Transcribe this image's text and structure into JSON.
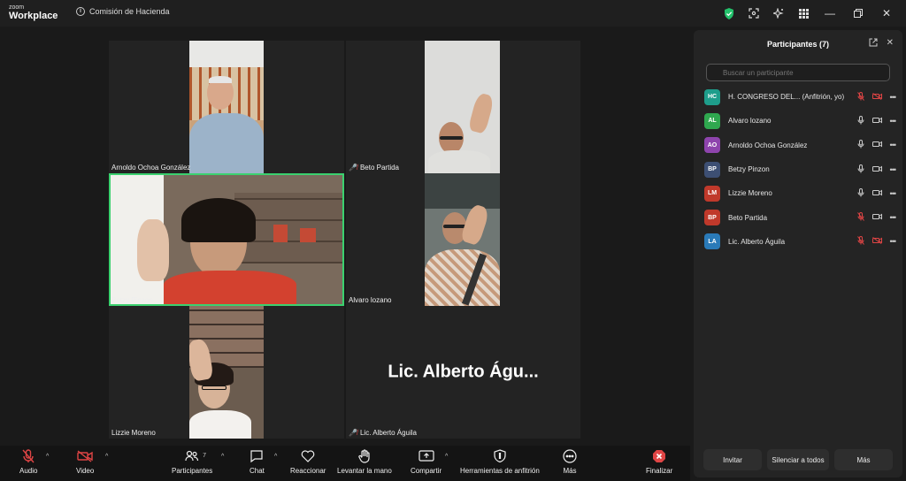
{
  "app": {
    "logo_small": "zoom",
    "logo_big": "Workplace",
    "meeting_title": "Comisión de Hacienda"
  },
  "colors": {
    "active_speaker": "#3bd16f",
    "muted": "#e04545",
    "secure": "#23c16b"
  },
  "tiles": [
    {
      "name": "Arnoldo Ochoa González",
      "muted": false
    },
    {
      "name": "Beto Partida",
      "muted": true
    },
    {
      "name": "Betzy Pinzon",
      "muted": false,
      "active": true
    },
    {
      "name": "Alvaro lozano",
      "muted": false
    },
    {
      "name": "Lizzie Moreno",
      "muted": false
    },
    {
      "name": "Lic. Alberto Águila",
      "muted": true,
      "display_name": "Lic. Alberto Águ..."
    }
  ],
  "toolbar": {
    "audio": "Audio",
    "video": "Video",
    "participants": "Participantes",
    "participants_count": "7",
    "chat": "Chat",
    "react": "Reaccionar",
    "raise_hand": "Levantar la mano",
    "share": "Compartir",
    "host_tools": "Herramientas de anfitrión",
    "more": "Más",
    "end": "Finalizar"
  },
  "panel": {
    "title": "Participantes (7)",
    "search_placeholder": "Buscar un participante",
    "participants": [
      {
        "initials": "HC",
        "name": "H. CONGRESO DEL...  (Anfitrión, yo)",
        "color": "#1e9d8b",
        "mic_muted": true,
        "video_off": true
      },
      {
        "initials": "AL",
        "name": "Alvaro lozano",
        "color": "#2fa84f",
        "mic_muted": false,
        "video_off": false
      },
      {
        "initials": "AO",
        "name": "Arnoldo Ochoa González",
        "color": "#8e44ad",
        "mic_muted": false,
        "video_off": false
      },
      {
        "initials": "BP",
        "name": "Betzy Pinzon",
        "color": "#3d4f73",
        "mic_muted": false,
        "video_off": false
      },
      {
        "initials": "LM",
        "name": "Lizzie Moreno",
        "color": "#c0392b",
        "mic_muted": false,
        "video_off": false
      },
      {
        "initials": "BP",
        "name": "Beto Partida",
        "color": "#c0392b",
        "mic_muted": true,
        "video_off": false
      },
      {
        "initials": "LA",
        "name": "Lic. Alberto Águila",
        "color": "#2a7ab8",
        "mic_muted": true,
        "video_off": true
      }
    ],
    "invite": "Invitar",
    "mute_all": "Silenciar a todos",
    "more": "Más"
  }
}
